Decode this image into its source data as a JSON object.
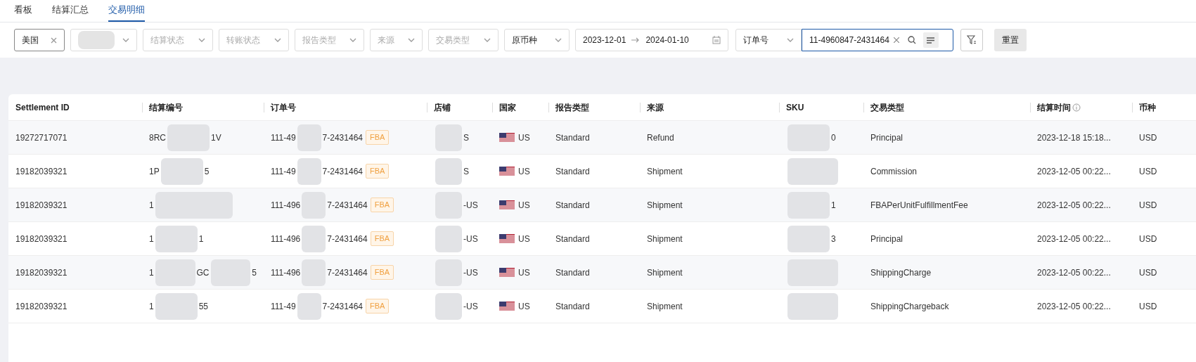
{
  "tabs": [
    {
      "label": "看板",
      "selected": false
    },
    {
      "label": "结算汇总",
      "selected": false
    },
    {
      "label": "交易明细",
      "selected": true
    }
  ],
  "filters": [
    {
      "kind": "tag",
      "value": "美国"
    },
    {
      "kind": "redacted"
    },
    {
      "kind": "select",
      "placeholder": "结算状态"
    },
    {
      "kind": "select",
      "placeholder": "转账状态"
    },
    {
      "kind": "select",
      "placeholder": "报告类型"
    },
    {
      "kind": "select",
      "placeholder": "来源"
    },
    {
      "kind": "select",
      "placeholder": "交易类型"
    },
    {
      "kind": "select",
      "value": "原币种"
    }
  ],
  "date_range": {
    "start": "2023-12-01",
    "end": "2024-01-10"
  },
  "search_field": {
    "select": "订单号",
    "value": "11-4960847-2431464"
  },
  "reset_button": "重置",
  "table": {
    "columns": [
      {
        "label": "Settlement ID",
        "info": false
      },
      {
        "label": "结算编号",
        "info": false
      },
      {
        "label": "订单号",
        "info": false
      },
      {
        "label": "店铺",
        "info": false
      },
      {
        "label": "国家",
        "info": false
      },
      {
        "label": "报告类型",
        "info": false
      },
      {
        "label": "来源",
        "info": false
      },
      {
        "label": "SKU",
        "info": false
      },
      {
        "label": "交易类型",
        "info": false
      },
      {
        "label": "结算时间",
        "info": true
      },
      {
        "label": "币种",
        "info": false
      }
    ],
    "rows": [
      {
        "settlement_id": "19272717071",
        "settlement_no": [
          "8RC",
          "1V"
        ],
        "order": [
          "111-49",
          "7-2431464"
        ],
        "badge": "FBA",
        "store": [
          "S"
        ],
        "country": "US",
        "report": "Standard",
        "source": "Refund",
        "sku": [
          "0"
        ],
        "type": "Principal",
        "time": "2023-12-18 15:18...",
        "currency": "USD"
      },
      {
        "settlement_id": "19182039321",
        "settlement_no": [
          "1P",
          "5"
        ],
        "order": [
          "111-49",
          "7-2431464"
        ],
        "badge": "FBA",
        "store": [
          "S"
        ],
        "country": "US",
        "report": "Standard",
        "source": "Shipment",
        "sku": [],
        "type": "Commission",
        "time": "2023-12-05 00:22...",
        "currency": "USD"
      },
      {
        "settlement_id": "19182039321",
        "settlement_no": [
          "1"
        ],
        "order": [
          "111-496",
          "7-2431464"
        ],
        "badge": "FBA",
        "store": [
          "-US"
        ],
        "country": "US",
        "report": "Standard",
        "source": "Shipment",
        "sku": [
          "1"
        ],
        "type": "FBAPerUnitFulfillmentFee",
        "time": "2023-12-05 00:22...",
        "currency": "USD"
      },
      {
        "settlement_id": "19182039321",
        "settlement_no": [
          "1",
          "1"
        ],
        "order": [
          "111-496",
          "7-2431464"
        ],
        "badge": "FBA",
        "store": [
          "-US"
        ],
        "country": "US",
        "report": "Standard",
        "source": "Shipment",
        "sku": [
          "3"
        ],
        "type": "Principal",
        "time": "2023-12-05 00:22...",
        "currency": "USD"
      },
      {
        "settlement_id": "19182039321",
        "settlement_no": [
          "1",
          "GC",
          "5"
        ],
        "order": [
          "111-496",
          "7-2431464"
        ],
        "badge": "FBA",
        "store": [
          "-US"
        ],
        "country": "US",
        "report": "Standard",
        "source": "Shipment",
        "sku": [],
        "type": "ShippingCharge",
        "time": "2023-12-05 00:22...",
        "currency": "USD"
      },
      {
        "settlement_id": "19182039321",
        "settlement_no": [
          "1",
          "55"
        ],
        "order": [
          "111-49",
          "7-2431464"
        ],
        "badge": "FBA",
        "store": [
          "-US"
        ],
        "country": "US",
        "report": "Standard",
        "source": "Shipment",
        "sku": [],
        "type": "ShippingChargeback",
        "time": "2023-12-05 00:22...",
        "currency": "USD"
      }
    ]
  }
}
